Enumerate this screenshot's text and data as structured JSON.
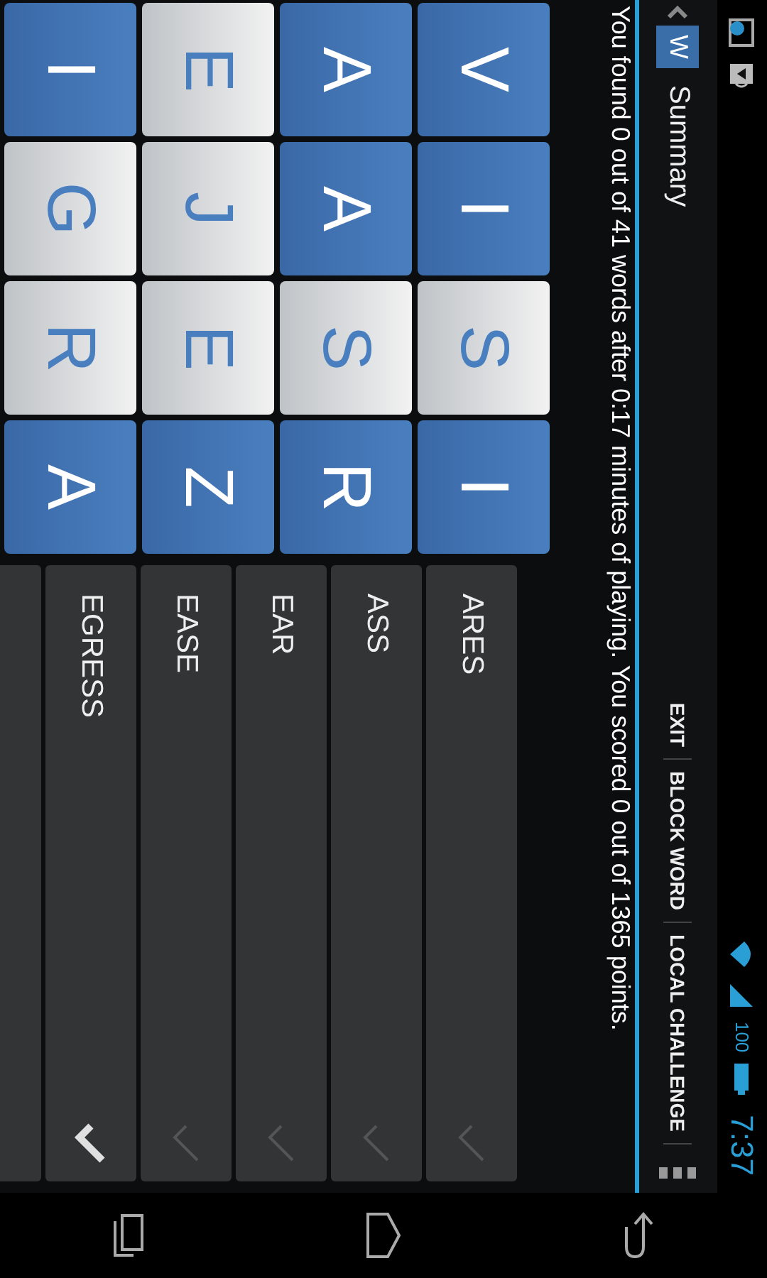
{
  "status_bar": {
    "battery": "100",
    "time": "7:37"
  },
  "action_bar": {
    "logo": "W",
    "title": "Summary",
    "actions": [
      "EXIT",
      "BLOCK WORD",
      "LOCAL CHALLENGE"
    ]
  },
  "message": "You found 0 out of 41 words after 0:17 minutes of playing. You scored 0 out of 1365 points.",
  "board": [
    {
      "letter": "V",
      "highlighted": false
    },
    {
      "letter": "I",
      "highlighted": false
    },
    {
      "letter": "S",
      "highlighted": true
    },
    {
      "letter": "I",
      "highlighted": false
    },
    {
      "letter": "A",
      "highlighted": false
    },
    {
      "letter": "A",
      "highlighted": false
    },
    {
      "letter": "S",
      "highlighted": true
    },
    {
      "letter": "R",
      "highlighted": false
    },
    {
      "letter": "E",
      "highlighted": true
    },
    {
      "letter": "J",
      "highlighted": true
    },
    {
      "letter": "E",
      "highlighted": true
    },
    {
      "letter": "Z",
      "highlighted": false
    },
    {
      "letter": "I",
      "highlighted": false
    },
    {
      "letter": "G",
      "highlighted": true
    },
    {
      "letter": "R",
      "highlighted": true
    },
    {
      "letter": "A",
      "highlighted": false
    }
  ],
  "words": [
    {
      "word": "ARES",
      "checked": false
    },
    {
      "word": "ASS",
      "checked": false
    },
    {
      "word": "EAR",
      "checked": false
    },
    {
      "word": "EASE",
      "checked": false
    },
    {
      "word": "EGRESS",
      "checked": true
    }
  ]
}
